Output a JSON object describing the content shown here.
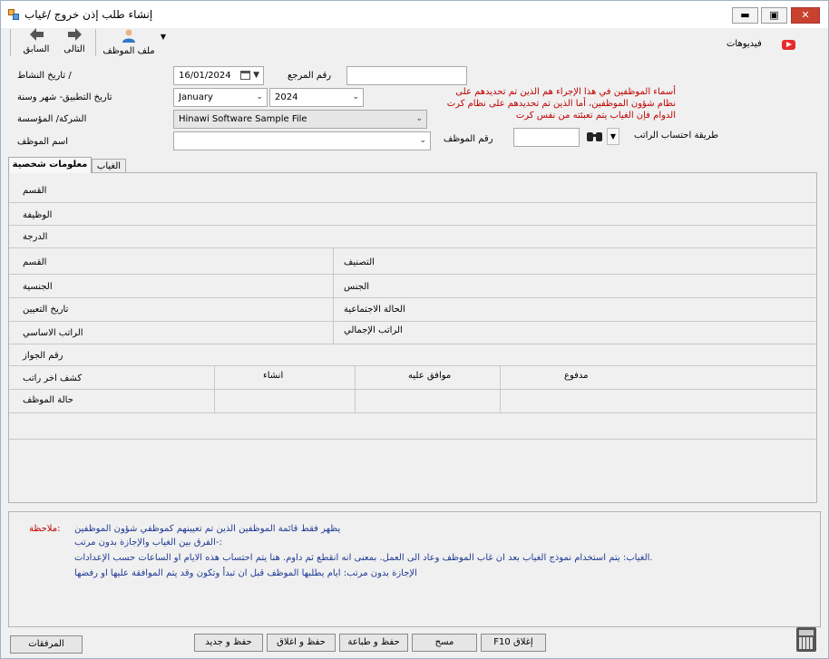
{
  "window": {
    "title": "إنشاء طلب إذن خروج /غياب",
    "controls": {
      "minimize": "▬",
      "maximize": "▣",
      "close": "✕"
    }
  },
  "toolbar": {
    "employee_file": "ملف الموظف",
    "next": "التالى",
    "previous": "السابق"
  },
  "videos_link": "فيديوهات",
  "form": {
    "activity_date_label": "/ تاريخ النشاط",
    "activity_date_value": "16/01/2024",
    "reference_label": "رقم المرجع",
    "reference_value": "",
    "period_label": "تاريخ التطبيق- شهر وسنة",
    "month_value": "January",
    "year_value": "2024",
    "company_label": "الشركة/ المؤسسة",
    "company_value": "Hinawi Software Sample File",
    "employee_name_label": "اسم الموظف",
    "employee_name_value": "",
    "employee_no_label": "رقم الموظف",
    "employee_no_value": "",
    "salary_method_label": "طريقة احتساب الراتب",
    "warning_text": "أسماء الموظفين في هذا الإجراء هم الذين تم تحديدهم على نظام شؤون الموظفين،  أما الذين تم تحديدهم على نظام كرت الدوام فإن الغياب يتم تعبئته من نفس كرت"
  },
  "tabs": [
    "معلومات شخصية",
    "الغياب"
  ],
  "personal_info": {
    "section": "القسم",
    "job": "الوظيفة",
    "grade": "الدرجة",
    "department": "القسم",
    "classification": "التصنيف",
    "nationality": "الجنسية",
    "gender": "الجنس",
    "hire_date": "تاريخ التعيين",
    "marital_status": "الحالة الاجتماعية",
    "basic_salary": "الراتب الاساسي",
    "total_salary": "الراتب الإجمالي",
    "passport_no": "رقم الجواز",
    "last_payslip": "كشف اخر راتب",
    "created": "انشاء",
    "approved": "موافق عليه",
    "paid": "مدفوع",
    "employee_status": "حالة الموظف"
  },
  "notes": {
    "heading": ":ملاحظة",
    "line1": "يظهر فقط قائمة الموظفين الذين تم تعيينهم كموظفي شؤون الموظفين",
    "line2": ":-الفرق بين الغياب والإجازة بدون مرتب",
    "line3": ".الغياب: يتم استخدام نموذج الغياب بعد ان غاب الموظف وعاد الى العمل. بمعنى انه انقطع ثم داوم. هنا يتم احتساب هذه الايام او الساعات حسب الإعدادات",
    "line4": "الإجازة بدون مرتب: ايام يطلبها الموظف قبل ان تبدأ وتكون وقد يتم الموافقة عليها او رفضها"
  },
  "buttons": {
    "attachments": "المرفقات",
    "save_new": "حفظ و جديد",
    "save_close": "حفظ و اغلاق",
    "save_print": "حفظ و طباعة",
    "clear": "مسح",
    "close_f10": "F10 إغلاق"
  }
}
